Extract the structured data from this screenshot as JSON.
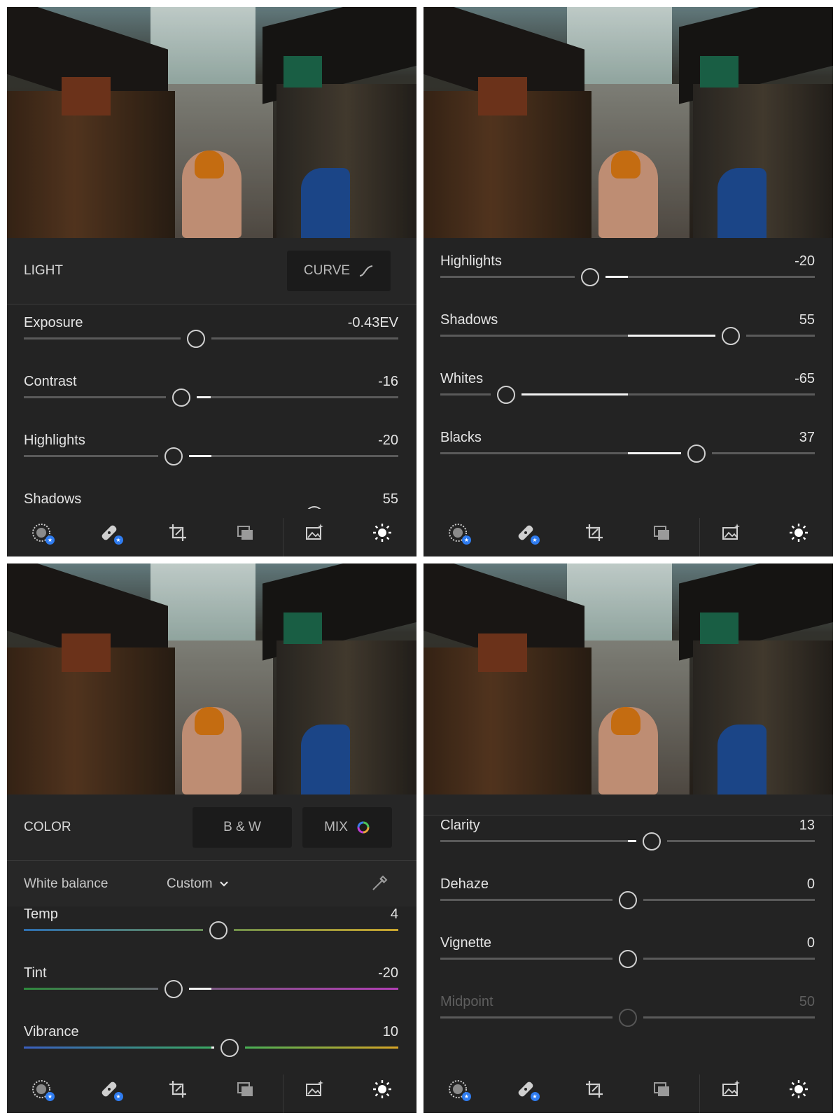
{
  "toolbar": {
    "icons": [
      "presets-icon",
      "healing-icon",
      "crop-icon",
      "versions-icon",
      "image-enhance-icon",
      "light-icon"
    ],
    "badge_symbol": "★"
  },
  "panel1": {
    "section_title": "LIGHT",
    "curve_label": "CURVE",
    "sliders": [
      {
        "label": "Exposure",
        "value": "-0.43EV",
        "position": 0.459
      },
      {
        "label": "Contrast",
        "value": "-16",
        "position": 0.42
      },
      {
        "label": "Highlights",
        "value": "-20",
        "position": 0.4
      },
      {
        "label": "Shadows",
        "value": "55",
        "position": 0.775
      }
    ]
  },
  "panel2": {
    "sliders": [
      {
        "label": "Highlights",
        "value": "-20",
        "position": 0.4
      },
      {
        "label": "Shadows",
        "value": "55",
        "position": 0.775
      },
      {
        "label": "Whites",
        "value": "-65",
        "position": 0.175
      },
      {
        "label": "Blacks",
        "value": "37",
        "position": 0.685
      }
    ]
  },
  "panel3": {
    "section_title": "COLOR",
    "bw_label": "B & W",
    "mix_label": "MIX",
    "white_balance_label": "White balance",
    "white_balance_value": "Custom",
    "sliders": [
      {
        "label": "Temp",
        "value": "4",
        "position": 0.52
      },
      {
        "label": "Tint",
        "value": "-20",
        "position": 0.4
      },
      {
        "label": "Vibrance",
        "value": "10",
        "position": 0.55
      }
    ]
  },
  "panel4": {
    "sliders": [
      {
        "label": "Clarity",
        "value": "13",
        "position": 0.565
      },
      {
        "label": "Dehaze",
        "value": "0",
        "position": 0.5
      },
      {
        "label": "Vignette",
        "value": "0",
        "position": 0.5
      },
      {
        "label": "Midpoint",
        "value": "50",
        "position": 0.5
      }
    ]
  }
}
